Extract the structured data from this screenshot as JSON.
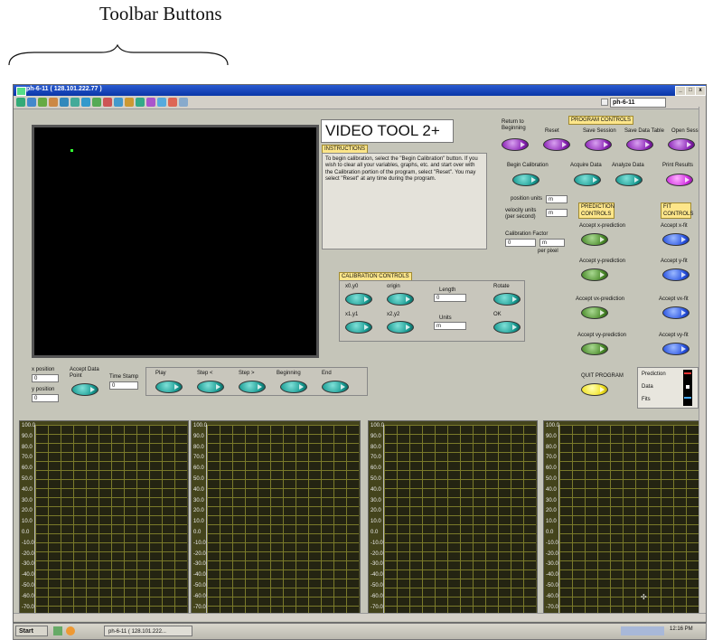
{
  "caption": "Toolbar Buttons",
  "window": {
    "title": "ph-6-11 ( 128.101.222.77 )",
    "vi_name": "ph-6-11"
  },
  "header": {
    "title": "VIDEO TOOL 2+",
    "instructions_label": "INSTRUCTIONS",
    "instructions_text": "To begin calibration, select the \"Begin Calibration\" button. If you wish to clear all your variables, graphs, etc. and start over with the Calibration portion of the program, select \"Reset\". You may select \"Reset\" at any time during the program."
  },
  "program_controls": {
    "label": "PROGRAM CONTROLS",
    "return_label": "Return to Beginning",
    "reset_label": "Reset",
    "save_session_label": "Save Session",
    "save_table_label": "Save Data Table",
    "open_session_label": "Open Sess",
    "begin_calibration_label": "Begin Calibration",
    "acquire_label": "Acquire Data",
    "analyze_label": "Analyze Data",
    "print_label": "Print Results"
  },
  "units": {
    "position_label": "position units",
    "position_value": "m",
    "velocity_label": "velocity units (per second)",
    "velocity_value": "m",
    "calibration_factor_label": "Calibration Factor",
    "calibration_factor_value": "0",
    "calibration_factor_unit": "m",
    "per_pixel": "per pixel"
  },
  "prediction_controls": {
    "label": "PREDICTION CONTROLS",
    "accept_x": "Accept x-prediction",
    "accept_y": "Accept y-prediction",
    "accept_vx": "Accept vx-prediction",
    "accept_vy": "Accept vy-prediction"
  },
  "fit_controls": {
    "label": "FIT CONTROLS",
    "accept_x": "Accept x-fit",
    "accept_y": "Accept y-fit",
    "accept_vx": "Accept vx-fit",
    "accept_vy": "Accept vy-fit"
  },
  "calibration": {
    "label": "CALIBRATION CONTROLS",
    "x0y0": "x0,y0",
    "origin": "origin",
    "length_label": "Length",
    "length_value": "0",
    "rotate": "Rotate",
    "x1y1": "x1,y1",
    "x2y2": "x2,y2",
    "units_label": "Units",
    "units_value": "m",
    "ok": "OK"
  },
  "point_panel": {
    "x_label": "x position",
    "x_value": "0",
    "y_label": "y position",
    "y_value": "0",
    "accept_label": "Accept Data Point",
    "timestamp_label": "Time Stamp",
    "timestamp_value": "0"
  },
  "playback": {
    "play": "Play",
    "step_back": "Step <",
    "step_fwd": "Step >",
    "beginning": "Beginning",
    "end": "End"
  },
  "quit_label": "QUIT PROGRAM",
  "legend": {
    "prediction": "Prediction",
    "data": "Data",
    "fits": "Fits"
  },
  "graph_ticks": [
    "100.0",
    "90.0",
    "80.0",
    "70.0",
    "60.0",
    "50.0",
    "40.0",
    "30.0",
    "20.0",
    "10.0",
    "0.0",
    "-10.0",
    "-20.0",
    "-30.0",
    "-40.0",
    "-50.0",
    "-60.0",
    "-70.0"
  ],
  "taskbar": {
    "start": "Start",
    "item": "ph-6-11 ( 128.101.222...",
    "clock": "12:16 PM"
  },
  "colors": {
    "teal": "#179a91",
    "purple": "#8a22b5",
    "green": "#4a8a2a",
    "blue": "#2852e0",
    "yellow": "#f0e020",
    "label_yellow": "#fde68a"
  },
  "icons": [
    "arrow-tool-icon",
    "tool-icon",
    "tool-icon",
    "tool-icon",
    "tool-icon",
    "tool-icon",
    "tool-icon",
    "tool-icon",
    "tool-icon",
    "tool-icon",
    "tool-icon",
    "tool-icon",
    "tool-icon",
    "tool-icon",
    "tool-icon",
    "tool-icon"
  ]
}
